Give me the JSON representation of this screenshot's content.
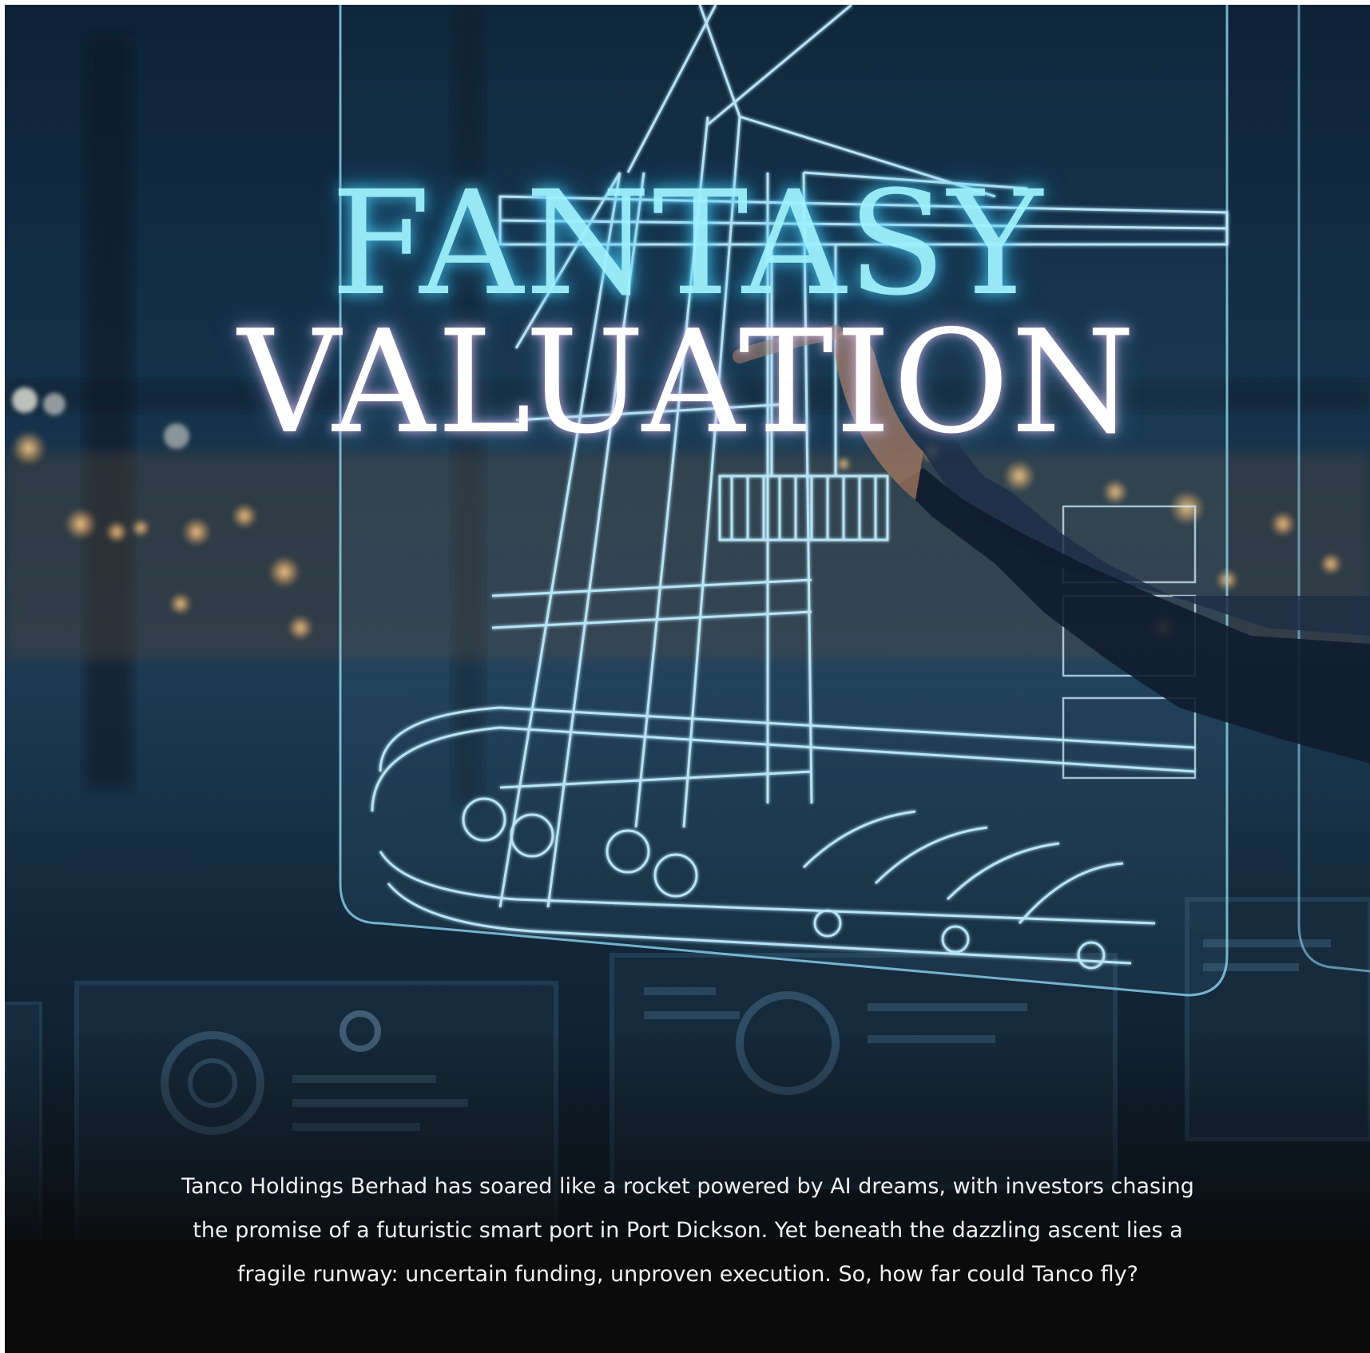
{
  "hero": {
    "title_line_1": "FANTASY",
    "title_line_2": "VALUATION",
    "standfirst": "Tanco Holdings Berhad has soared like a rocket powered by AI dreams, with investors chasing the promise of a futuristic smart port in Port Dickson. Yet beneath the dazzling ascent lies a fragile runway: uncertain funding, unproven execution. So, how far could Tanco fly?"
  },
  "colors": {
    "title_glow": "#9ff2ff",
    "hologram_line": "#bfeeff",
    "background": "#0d2236",
    "text": "#f1f1f1"
  },
  "imagery": {
    "background": "blurred port at night with glowing dashboards",
    "hologram": "crane-icon"
  }
}
